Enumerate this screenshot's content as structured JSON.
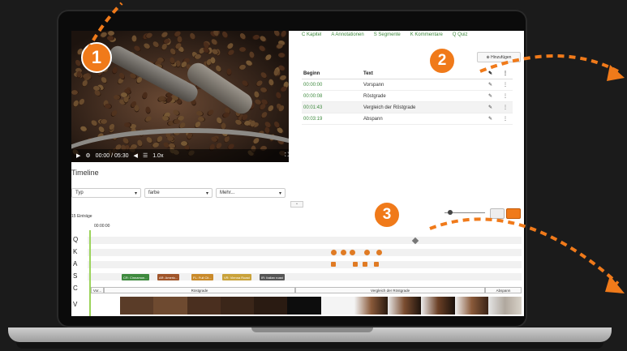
{
  "badges": {
    "one": "1",
    "two": "2",
    "three": "3"
  },
  "video": {
    "time": "00:00 / 05:30",
    "speed": "1.0x"
  },
  "tabs": [
    "C Kapitel",
    "A Annotationen",
    "S Segmente",
    "K Kommentare",
    "Q Quiz"
  ],
  "right_panel": {
    "add_button": "Hinzufügen"
  },
  "segments_table": {
    "headers": [
      "Beginn",
      "Text"
    ],
    "rows": [
      {
        "begin": "00:00:00",
        "text": "Vorspann"
      },
      {
        "begin": "00:00:08",
        "text": "Röstgrade"
      },
      {
        "begin": "00:01:43",
        "text": "Vergleich der Röstgrade"
      },
      {
        "begin": "00:03:19",
        "text": "Abspann"
      }
    ]
  },
  "timeline": {
    "title": "Timeline",
    "filters": [
      {
        "value": "Typ"
      },
      {
        "value": "farbe"
      },
      {
        "value": "Mehr..."
      }
    ],
    "entries_count": "15 Einträge",
    "ruler_time": "00:00:00",
    "track_labels": [
      "Q",
      "K",
      "A",
      "S",
      "C",
      "V"
    ],
    "segment_chips": [
      {
        "label": "CR: Cinnamon...",
        "color": "#3e8a3e"
      },
      {
        "label": "AR: Americ...",
        "color": "#a0552a"
      },
      {
        "label": "FL: Full Cit...",
        "color": "#c98a2a"
      },
      {
        "label": "VR: Vienna Roast",
        "color": "#c9a23a"
      },
      {
        "label": "IR: Italian roast",
        "color": "#555555"
      }
    ],
    "chapters": [
      {
        "label": "Vor..."
      },
      {
        "label": "Röstgrade"
      },
      {
        "label": "Vergleich der Röstgrade"
      },
      {
        "label": "Abspann"
      }
    ]
  },
  "colors": {
    "accent": "#3e8a3e",
    "annotation": "#f07a1a"
  }
}
